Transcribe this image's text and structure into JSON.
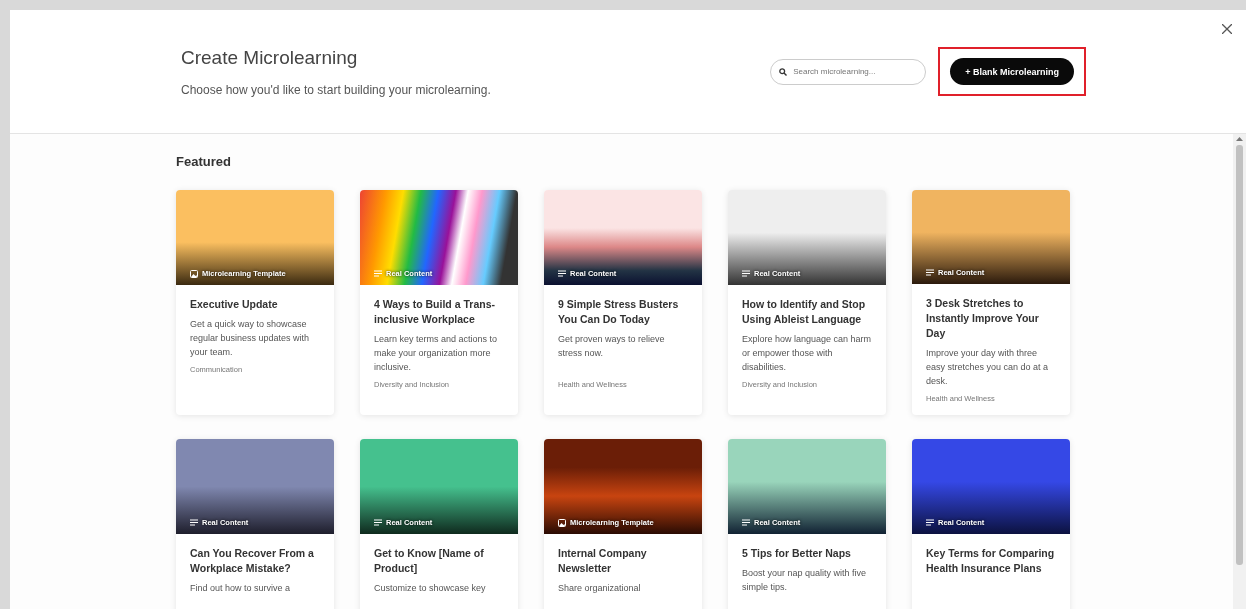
{
  "header": {
    "title": "Create Microlearning",
    "subtitle": "Choose how you'd like to start building your microlearning.",
    "search": {
      "placeholder": "Search microlearning..."
    },
    "primary_button": "+ Blank Microlearning"
  },
  "section_title": "Featured",
  "cards": [
    {
      "kind": "template",
      "badge": "Microlearning Template",
      "title": "Executive Update",
      "description": "Get a quick way to showcase regular business updates with your team.",
      "category": "Communication"
    },
    {
      "kind": "real",
      "badge": "Real Content",
      "title": "4 Ways to Build a Trans-inclusive Workplace",
      "description": "Learn key terms and actions to make your organization more inclusive.",
      "category": "Diversity and Inclusion"
    },
    {
      "kind": "real",
      "badge": "Real Content",
      "title": "9 Simple Stress Busters You Can Do Today",
      "description": "Get proven ways to relieve stress now.",
      "category": "Health and Wellness"
    },
    {
      "kind": "real",
      "badge": "Real Content",
      "title": "How to Identify and Stop Using Ableist Language",
      "description": "Explore how language can harm or empower those with disabilities.",
      "category": "Diversity and Inclusion"
    },
    {
      "kind": "real",
      "badge": "Real Content",
      "title": "3 Desk Stretches to Instantly Improve Your Day",
      "description": "Improve your day with three easy stretches you can do at a desk.",
      "category": "Health and Wellness"
    },
    {
      "kind": "real",
      "badge": "Real Content",
      "title": "Can You Recover From a Workplace Mistake?",
      "description": "Find out how to survive a"
    },
    {
      "kind": "real",
      "badge": "Real Content",
      "title": "Get to Know [Name of Product]",
      "description": "Customize to showcase key"
    },
    {
      "kind": "template",
      "badge": "Microlearning Template",
      "title": "Internal Company Newsletter",
      "description": "Share organizational"
    },
    {
      "kind": "real",
      "badge": "Real Content",
      "title": "5 Tips for Better Naps",
      "description": "Boost your nap quality with five simple tips."
    },
    {
      "kind": "real",
      "badge": "Real Content",
      "title": "Key Terms for Comparing Health Insurance Plans"
    }
  ]
}
